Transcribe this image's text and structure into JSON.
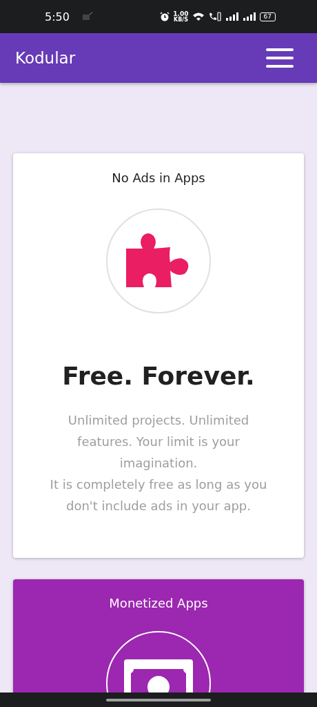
{
  "status_bar": {
    "time": "5:50",
    "speed_value": "1.00",
    "speed_unit": "KB/S",
    "battery": "67"
  },
  "app_bar": {
    "title": "Kodular"
  },
  "cards": [
    {
      "kind": "free",
      "heading": "No Ads in Apps",
      "title": "Free. Forever.",
      "description": [
        "Unlimited projects. Unlimited features. Your limit is your imagination.",
        "It is completely free as long as you don't include ads in your app."
      ]
    },
    {
      "kind": "monetized",
      "heading": "Monetized Apps"
    }
  ]
}
